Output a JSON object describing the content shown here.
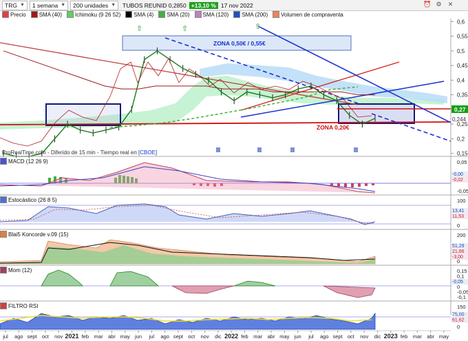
{
  "toolbar": {
    "symbol": "TRG",
    "timeframe": "1 semana",
    "units": "200 unidades",
    "instrument": "TUBOS REUNID",
    "price": "0,2850",
    "change": "+13,10 %",
    "date": "17 nov 2022",
    "icons": [
      "alarm-icon",
      "settings-icon",
      "close-icon"
    ]
  },
  "legend": [
    {
      "label": "Precio",
      "color": "#e04040"
    },
    {
      "label": "SMA (40)",
      "color": "#a01a1a"
    },
    {
      "label": "Ichimoku (9 26 52)",
      "color": "#60d060"
    },
    {
      "label": "SMA (4)",
      "color": "#000000"
    },
    {
      "label": "SMA (20)",
      "color": "#40b040"
    },
    {
      "label": "SMA (120)",
      "color": "#c080c0"
    },
    {
      "label": "SMA (200)",
      "color": "#2050c0"
    },
    {
      "label": "Volumen de compraventa",
      "color": "#f08060"
    }
  ],
  "source_note": "ProRealTime.com - Diferido de 15 min - Tiempo real en",
  "source_link": "[CBOE]",
  "annotations": {
    "zone_top": "ZONA 0,50€ / 0,55€",
    "zone_bottom": "ZONA 0,20€"
  },
  "price_axis": [
    "0,6",
    "0,55",
    "0,5",
    "0,45",
    "0,4",
    "0,35",
    "0,3",
    "0,25",
    "0,2",
    "0,15"
  ],
  "price_badges": {
    "last": "0,27",
    "low": "0,244"
  },
  "panels": [
    {
      "label": "MACD (12 26 9)",
      "ticks": [
        "0,05",
        "0",
        "-0,05"
      ],
      "readouts": [
        "-0,00",
        "-0,02"
      ]
    },
    {
      "label": "Estocástico (26 8 5)",
      "ticks": [
        "100",
        "0"
      ],
      "readouts": [
        "13,41",
        "11,53"
      ]
    },
    {
      "label": "Blai5 Koncorde v.09 (15)",
      "ticks": [
        "200",
        "100",
        "0"
      ],
      "readouts": [
        "51,29",
        "21,66",
        "-3,00"
      ]
    },
    {
      "label": "Mom (12)",
      "ticks": [
        "0,15",
        "0,1",
        "0,05",
        "0",
        "-0,05",
        "-0,1"
      ],
      "readouts": [
        "-0,05"
      ]
    },
    {
      "label": "FILTRO RSI",
      "ticks": [
        "150",
        "100",
        "50",
        "0"
      ],
      "readouts": [
        "75,00",
        "61,62"
      ]
    }
  ],
  "x_axis": {
    "labels": [
      "jul",
      "ago",
      "sept",
      "oct",
      "nov",
      "2021",
      "feb",
      "mar",
      "abr",
      "may",
      "jun",
      "jul",
      "ago",
      "sept",
      "oct",
      "nov",
      "dic",
      "2022",
      "feb",
      "mar",
      "abr",
      "may",
      "jun",
      "jul",
      "ago",
      "sept",
      "oct",
      "nov",
      "dic",
      "2023",
      "feb",
      "mar",
      "abr",
      "may"
    ]
  },
  "chart_data": {
    "type": "line",
    "x_range": [
      "2020-07",
      "2023-05"
    ],
    "ylim": [
      0.14,
      0.61
    ],
    "series": [
      {
        "name": "Precio",
        "values": [
          0.15,
          0.14,
          0.14,
          0.15,
          0.2,
          0.25,
          0.23,
          0.22,
          0.23,
          0.24,
          0.3,
          0.47,
          0.5,
          0.47,
          0.44,
          0.42,
          0.4,
          0.36,
          0.33,
          0.36,
          0.35,
          0.34,
          0.35,
          0.37,
          0.38,
          0.35,
          0.33,
          0.28,
          0.25,
          0.27
        ]
      },
      {
        "name": "SMA (40)",
        "values": [
          0.5,
          0.48,
          0.46,
          0.44,
          0.42,
          0.4,
          0.38,
          0.37,
          0.37,
          0.38,
          0.38,
          0.38,
          0.38,
          0.37,
          0.37,
          0.37,
          0.36,
          0.36,
          0.36,
          0.36,
          0.36,
          0.35,
          0.35
        ]
      }
    ]
  }
}
